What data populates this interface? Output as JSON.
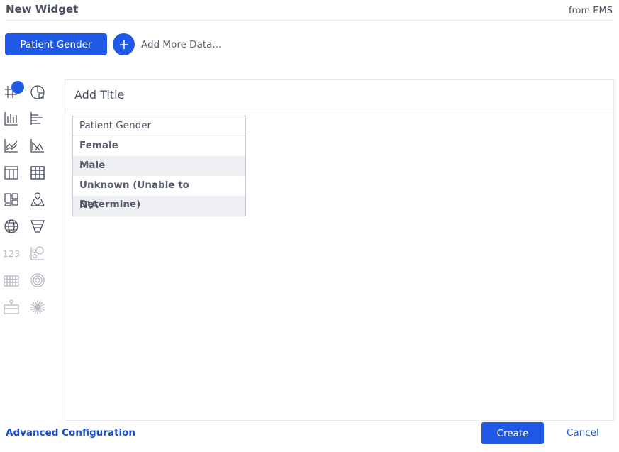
{
  "header": {
    "title": "New Widget",
    "source": "from EMS"
  },
  "data_selection": {
    "selected": "Patient Gender",
    "add_more": "Add More Data..."
  },
  "chart_types": [
    "table-icon",
    "pie-chart-icon",
    "bar-chart-icon",
    "horizontal-bar-icon",
    "line-chart-icon",
    "area-chart-icon",
    "grid-table-icon",
    "pivot-table-icon",
    "treemap-icon",
    "map-icon",
    "globe-icon",
    "funnel-icon",
    "number-icon",
    "bubble-chart-icon",
    "heatmap-icon",
    "radial-icon",
    "waterfall-icon",
    "burst-icon"
  ],
  "number_icon_text": "123",
  "panel": {
    "title": "Add Title",
    "table": {
      "header": "Patient Gender",
      "rows": [
        "Female",
        "Male",
        "Unknown (Unable to Determine)",
        "N\\A"
      ]
    }
  },
  "footer": {
    "advanced": "Advanced Configuration",
    "create": "Create",
    "cancel": "Cancel"
  },
  "colors": {
    "accent": "#1f59e6",
    "text": "#4a5161",
    "icon": "#4a5161",
    "icon_disabled": "#b4b9c2"
  }
}
